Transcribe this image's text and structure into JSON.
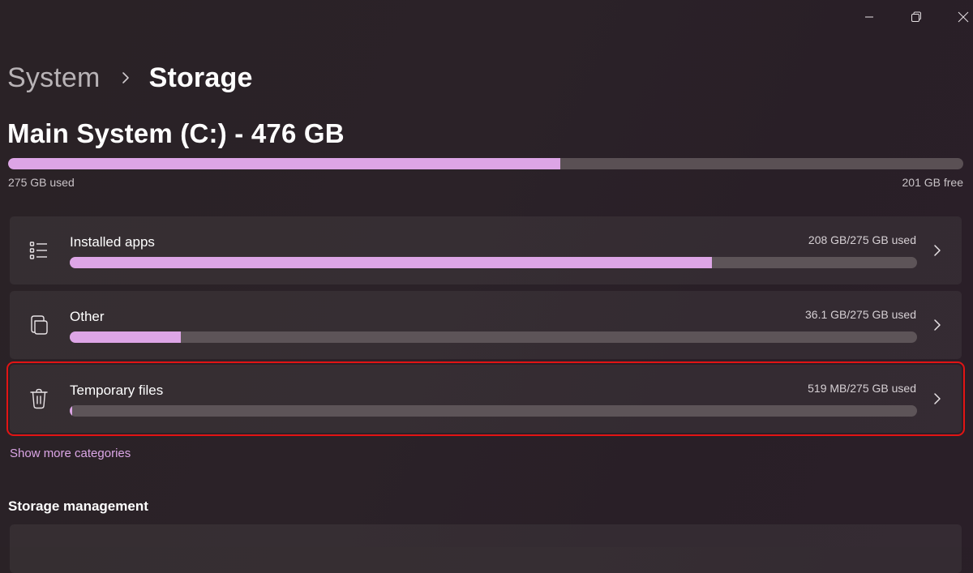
{
  "window": {
    "minimize_icon": "minimize-icon",
    "restore_icon": "restore-icon",
    "close_icon": "close-icon"
  },
  "breadcrumb": {
    "parent": "System",
    "separator_icon": "chevron-right-icon",
    "current": "Storage"
  },
  "drive": {
    "title": "Main System (C:) - 476 GB",
    "used_label": "275 GB used",
    "free_label": "201 GB free",
    "used_fraction": 0.578,
    "accent_color": "#dda5e6",
    "track_color": "#5a5054"
  },
  "categories": [
    {
      "label": "Installed apps",
      "usage": "208 GB/275 GB used",
      "fraction": 0.758,
      "icon": "list-icon",
      "chevron_icon": "chevron-right-icon"
    },
    {
      "label": "Other",
      "usage": "36.1 GB/275 GB used",
      "fraction": 0.131,
      "icon": "documents-icon",
      "chevron_icon": "chevron-right-icon"
    },
    {
      "label": "Temporary files",
      "usage": "519 MB/275 GB used",
      "fraction": 0.002,
      "icon": "trash-icon",
      "chevron_icon": "chevron-right-icon",
      "highlight_color": "#e21414"
    }
  ],
  "show_more_label": "Show more categories",
  "storage_management": {
    "heading": "Storage management"
  }
}
